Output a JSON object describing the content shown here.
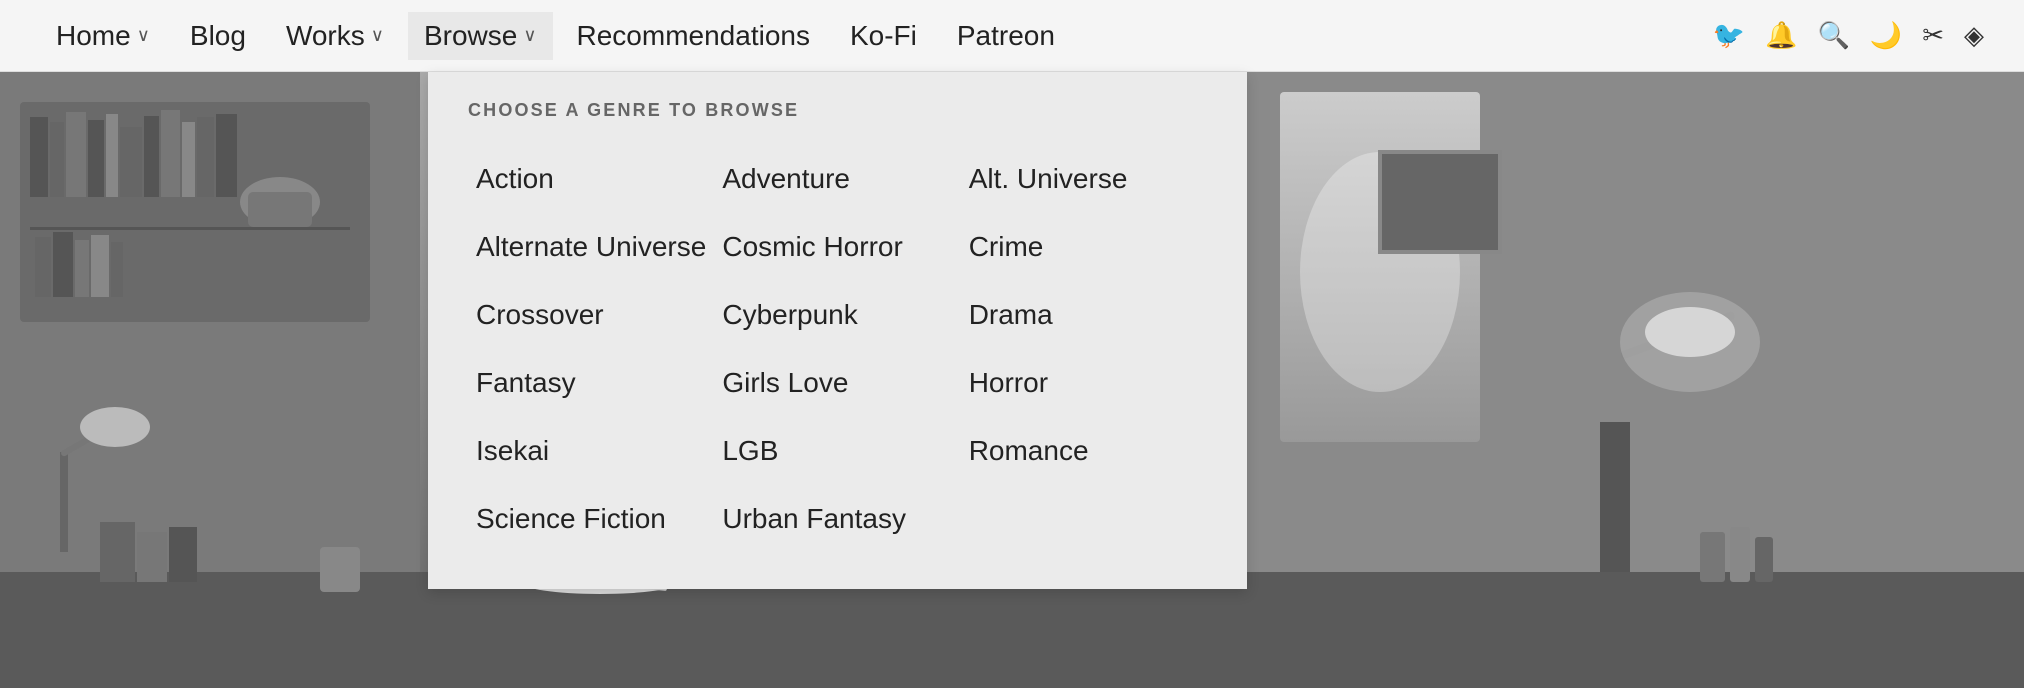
{
  "navbar": {
    "items": [
      {
        "label": "Home",
        "has_dropdown": true
      },
      {
        "label": "Blog",
        "has_dropdown": false
      },
      {
        "label": "Works",
        "has_dropdown": true
      },
      {
        "label": "Browse",
        "has_dropdown": true,
        "active": true
      },
      {
        "label": "Recommendations",
        "has_dropdown": false
      },
      {
        "label": "Ko-Fi",
        "has_dropdown": false
      },
      {
        "label": "Patreon",
        "has_dropdown": false
      }
    ],
    "icons": [
      {
        "name": "user-icon",
        "glyph": "🐦"
      },
      {
        "name": "bell-icon",
        "glyph": "🔔"
      },
      {
        "name": "search-icon",
        "glyph": "🔍"
      },
      {
        "name": "moon-icon",
        "glyph": "🌙"
      },
      {
        "name": "tools-icon",
        "glyph": "✂"
      },
      {
        "name": "rss-icon",
        "glyph": "◈"
      }
    ]
  },
  "dropdown": {
    "header": "CHOOSE A GENRE TO BROWSE",
    "genres": [
      {
        "col": 0,
        "label": "Action"
      },
      {
        "col": 1,
        "label": "Adventure"
      },
      {
        "col": 2,
        "label": "Alt. Universe"
      },
      {
        "col": 0,
        "label": "Alternate Universe"
      },
      {
        "col": 1,
        "label": "Cosmic Horror"
      },
      {
        "col": 2,
        "label": "Crime"
      },
      {
        "col": 0,
        "label": "Crossover"
      },
      {
        "col": 1,
        "label": "Cyberpunk"
      },
      {
        "col": 2,
        "label": "Drama"
      },
      {
        "col": 0,
        "label": "Fantasy"
      },
      {
        "col": 1,
        "label": "Girls Love"
      },
      {
        "col": 2,
        "label": "Horror"
      },
      {
        "col": 0,
        "label": "Isekai"
      },
      {
        "col": 1,
        "label": "LGB"
      },
      {
        "col": 2,
        "label": "Romance"
      },
      {
        "col": 0,
        "label": "Science Fiction"
      },
      {
        "col": 1,
        "label": "Urban Fantasy"
      },
      {
        "col": 2,
        "label": ""
      }
    ]
  }
}
